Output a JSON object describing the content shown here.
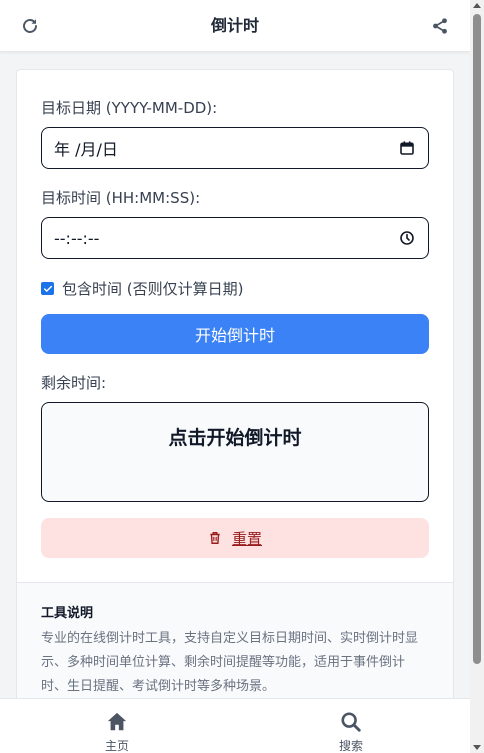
{
  "header": {
    "title": "倒计时",
    "left_icon": "refresh-icon",
    "right_icon": "share-icon"
  },
  "form": {
    "date_label": "目标日期 (YYYY-MM-DD):",
    "date_value": "年 /月/日",
    "time_label": "目标时间 (HH:MM:SS):",
    "time_value": "--:--:--",
    "include_time_label": "包含时间 (否则仅计算日期)",
    "include_time_checked": true,
    "start_button": "开始倒计时",
    "remaining_label": "剩余时间:",
    "countdown_message": "点击开始倒计时",
    "reset_button": "重置"
  },
  "info": {
    "title": "工具说明",
    "body": "专业的在线倒计时工具，支持自定义目标日期时间、实时倒计时显示、多种时间单位计算、剩余时间提醒等功能，适用于事件倒计时、生日提醒、考试倒计时等多种场景。"
  },
  "bottom_nav": {
    "items": [
      {
        "label": "主页",
        "icon": "home-icon"
      },
      {
        "label": "搜索",
        "icon": "search-icon"
      }
    ]
  },
  "colors": {
    "primary": "#3b82f6",
    "reset_bg": "#fee2e2",
    "reset_text": "#991b1b"
  }
}
